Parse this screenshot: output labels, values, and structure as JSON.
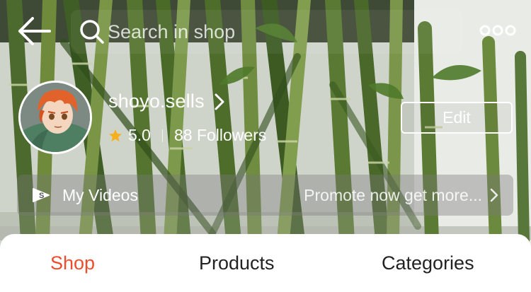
{
  "colors": {
    "accent": "#ee4d2d",
    "star": "#f6b01e",
    "text_on_photo": "#ffffff"
  },
  "top_bar": {
    "back_icon": "back-arrow-icon",
    "search": {
      "icon": "search-icon",
      "placeholder": "Search in shop",
      "value": ""
    },
    "more_icon": "more-options-icon"
  },
  "shop": {
    "avatar_icon": "shop-avatar",
    "name": "shoyo.sells",
    "name_chevron_icon": "chevron-right-icon",
    "rating": "5.0",
    "followers": "88 Followers",
    "edit_label": "Edit"
  },
  "videos_bar": {
    "icon": "shop-video-icon",
    "icon_letter": "S",
    "label": "My Videos",
    "promo_text": "Promote now get more...",
    "chevron_icon": "chevron-right-icon"
  },
  "tabs": [
    {
      "label": "Shop",
      "active": true
    },
    {
      "label": "Products",
      "active": false
    },
    {
      "label": "Categories",
      "active": false
    }
  ]
}
